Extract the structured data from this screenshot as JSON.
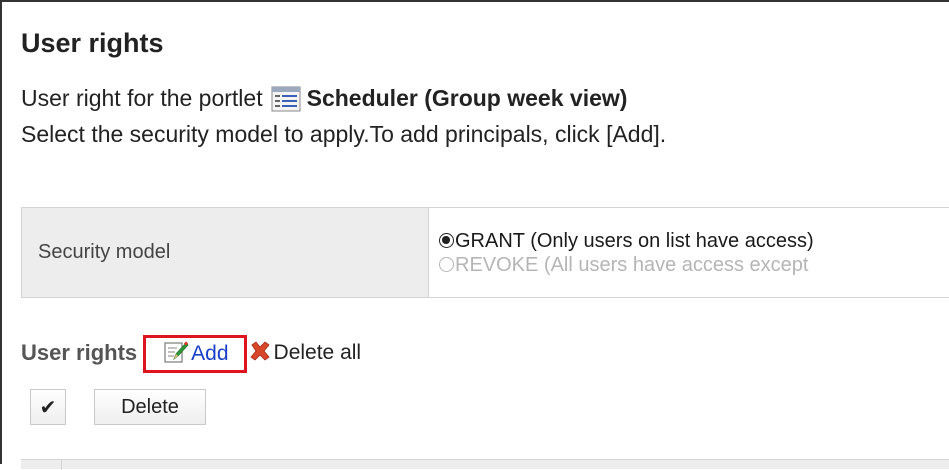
{
  "page": {
    "title": "User rights",
    "portlet_prefix": "User right for the portlet",
    "portlet_name": "Scheduler (Group week view)",
    "instruction": "Select the security model to apply.To add principals, click [Add]."
  },
  "security": {
    "label": "Security model",
    "options": [
      {
        "label": "GRANT (Only users on list have access)",
        "selected": true
      },
      {
        "label": "REVOKE (All users have access except",
        "selected": false
      }
    ]
  },
  "rights": {
    "label": "User rights",
    "add_label": "Add",
    "delete_all_label": "Delete all"
  },
  "actions": {
    "check_glyph": "✔",
    "delete_label": "Delete"
  },
  "icons": {
    "portlet": "scheduler-list-icon",
    "add": "edit-pencil-icon",
    "delete_all": "red-x-icon"
  },
  "colors": {
    "highlight": "#e0141e",
    "link": "#1a3fc8",
    "label_bg": "#ededed"
  }
}
